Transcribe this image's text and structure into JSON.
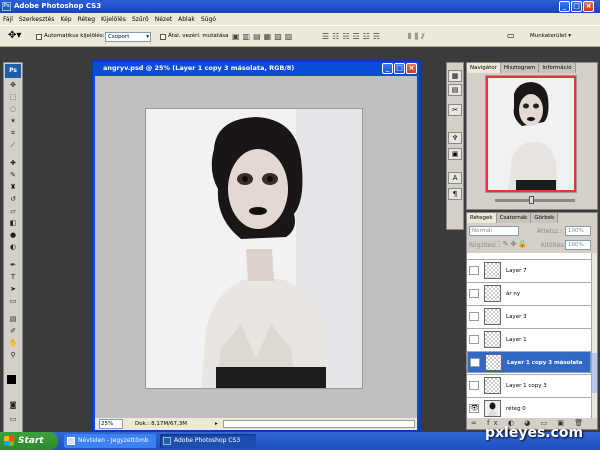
{
  "app": {
    "title": "Adobe Photoshop CS3",
    "logo_label": "Ps",
    "taskbar_photoshop": "Adobe Photoshop CS3"
  },
  "menu": [
    "Fájl",
    "Szerkesztés",
    "Kép",
    "Réteg",
    "Kijelölés",
    "Szűrő",
    "Nézet",
    "Ablak",
    "Súgó"
  ],
  "options": {
    "auto_select_label": "Automatikus kijelölés:",
    "auto_select_value": "Csoport",
    "show_transform_label": "Átal. vezérl. mutatása",
    "workspace_label": "Munkaterület"
  },
  "document": {
    "title": "angryv.psd @ 25% (Layer 1 copy 3 másolata, RGB/8)",
    "zoom": "25%",
    "doc_size": "Dok.: 8,17M/67,3M"
  },
  "navigator": {
    "tabs": [
      "Navigátor",
      "Hisztogram",
      "Információ"
    ]
  },
  "layers": {
    "tabs": [
      "Rétegek",
      "Csatornák",
      "Görbék"
    ],
    "blend_mode": "Normál",
    "opacity_label": "Áttetsz.:",
    "opacity_value": "100%",
    "lock_label": "Rögzítés:",
    "fill_label": "Kitöltés:",
    "fill_value": "100%",
    "items": [
      {
        "name": "Layer 7",
        "selected": false,
        "visible": false
      },
      {
        "name": "ár ny",
        "selected": false,
        "visible": false
      },
      {
        "name": "Layer 3",
        "selected": false,
        "visible": false
      },
      {
        "name": "Layer 1",
        "selected": false,
        "visible": false
      },
      {
        "name": "Layer 1 copy 3 másolata",
        "selected": true,
        "visible": false
      },
      {
        "name": "Layer 1 copy 3",
        "selected": false,
        "visible": false
      },
      {
        "name": "réteg 0",
        "selected": false,
        "visible": true
      }
    ]
  },
  "taskbar": {
    "start": "Start",
    "notepad": "Névtelen - Jegyzettömb"
  },
  "watermark": "pxleyes.com",
  "colors": {
    "titlebar": "#1a44b8",
    "selection": "#3169c6",
    "taskbar": "#1e4fc0",
    "start": "#2c8a2c"
  }
}
